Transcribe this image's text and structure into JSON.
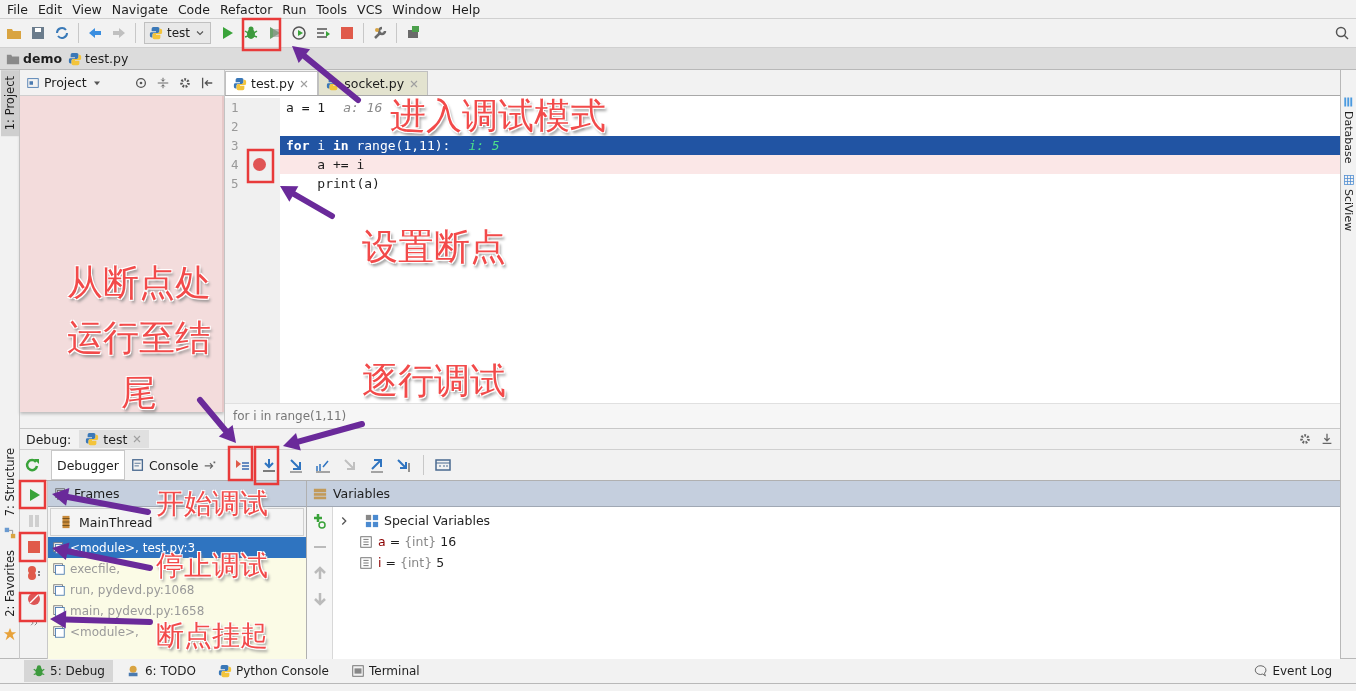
{
  "menu": [
    "File",
    "Edit",
    "View",
    "Navigate",
    "Code",
    "Refactor",
    "Run",
    "Tools",
    "VCS",
    "Window",
    "Help"
  ],
  "toolbar": {
    "run_config": "test"
  },
  "breadcrumb": [
    "demo",
    "test.py"
  ],
  "left_strip": [
    {
      "label": "1: Project",
      "selected": true
    },
    {
      "label": "7: Structure",
      "selected": false
    },
    {
      "label": "2: Favorites",
      "selected": false
    }
  ],
  "project_panel": {
    "title": "Project"
  },
  "editor": {
    "tabs": [
      {
        "label": "test.py",
        "selected": true
      },
      {
        "label": "socket.py",
        "selected": false
      }
    ],
    "lines": [
      {
        "number": "1",
        "code": "a = 1",
        "hint": "a: 16",
        "current": false,
        "breakpoint": false
      },
      {
        "number": "2",
        "current": false,
        "breakpoint": false
      },
      {
        "number": "3",
        "code": "**for** i **in** range(1,11):",
        "hint": "i: 5",
        "current": true,
        "breakpoint": false
      },
      {
        "number": "4",
        "code": "    a += i",
        "current": false,
        "breakpoint": true
      },
      {
        "number": "5",
        "code": "    print(a)",
        "current": false,
        "breakpoint": false
      }
    ],
    "footer": "for i in range(1,11)"
  },
  "right_strip": [
    "Database",
    "SciView"
  ],
  "debug": {
    "label": "Debug:",
    "session": "test",
    "tabs": [
      {
        "label": "Debugger",
        "selected": true
      },
      {
        "label": "Console",
        "selected": false
      }
    ],
    "frames_title": "Frames",
    "thread": "MainThread",
    "frames": [
      {
        "label": "<module>, test.py:3",
        "selected": true
      },
      {
        "label": "execfile,",
        "selected": false
      },
      {
        "label": "run, pydevd.py:1068",
        "selected": false
      },
      {
        "label": "main, pydevd.py:1658",
        "selected": false
      },
      {
        "label": "<module>,",
        "selected": false
      }
    ],
    "variables_title": "Variables",
    "variables": [
      {
        "kind": "group",
        "name": "Special Variables",
        "expanded": false
      },
      {
        "kind": "value",
        "name": "a",
        "operator": "=",
        "type": "{int}",
        "value": "16"
      },
      {
        "kind": "value",
        "name": "i",
        "operator": "=",
        "type": "{int}",
        "value": "5"
      }
    ]
  },
  "tool_windows": [
    {
      "label": "5: Debug",
      "selected": true
    },
    {
      "label": "6: TODO",
      "selected": false
    },
    {
      "label": "Python Console",
      "selected": false
    },
    {
      "label": "Terminal",
      "selected": false
    }
  ],
  "event_log": "Event Log",
  "annotations": [
    {
      "text": "进入调试模式"
    },
    {
      "text": "设置断点"
    },
    {
      "text": "从断点处运行至结尾"
    },
    {
      "text": "逐行调试"
    },
    {
      "text": "开始调试"
    },
    {
      "text": "停止调试"
    },
    {
      "text": "断点挂起"
    }
  ]
}
